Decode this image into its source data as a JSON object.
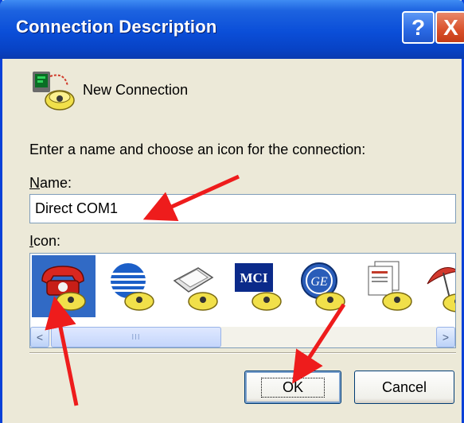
{
  "window": {
    "title": "Connection Description",
    "help_button": "?",
    "close_button": "X"
  },
  "header": {
    "label": "New Connection"
  },
  "form": {
    "prompt": "Enter a name and choose an icon for the connection:",
    "name_label": "Name:",
    "name_value": "Direct COM1",
    "icon_label": "Icon:"
  },
  "icons": [
    {
      "name": "red-phone-icon",
      "selected": true
    },
    {
      "name": "globe-phone-icon",
      "selected": false
    },
    {
      "name": "fax-phone-icon",
      "selected": false
    },
    {
      "name": "mci-phone-icon",
      "selected": false
    },
    {
      "name": "ge-phone-icon",
      "selected": false
    },
    {
      "name": "documents-phone-icon",
      "selected": false
    },
    {
      "name": "umbrella-phone-icon",
      "selected": false
    }
  ],
  "scrollbar": {
    "left": "<",
    "right": ">",
    "thumb": "III"
  },
  "buttons": {
    "ok": "OK",
    "cancel": "Cancel"
  },
  "colors": {
    "title_bar": "#0a4ed8",
    "selection": "#316ac5",
    "arrow": "#ee1c1c",
    "dialog": "#ece9d8"
  }
}
